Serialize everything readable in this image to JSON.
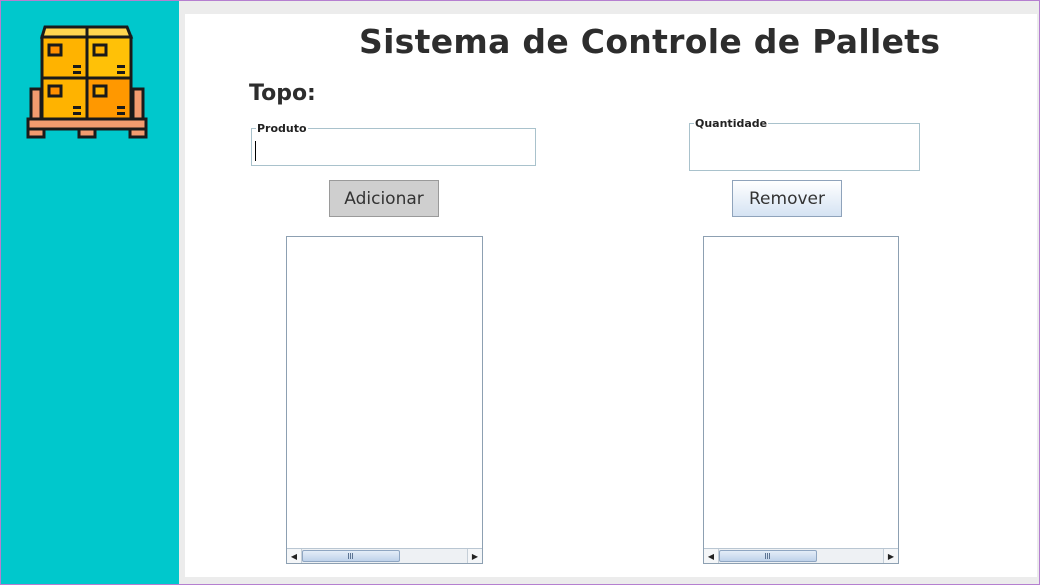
{
  "app": {
    "title": "Sistema de Controle de Pallets",
    "section_label": "Topo:"
  },
  "form": {
    "produto": {
      "legend": "Produto",
      "value": ""
    },
    "quantidade": {
      "legend": "Quantidade",
      "value": ""
    }
  },
  "buttons": {
    "add_label": "Adicionar",
    "remove_label": "Remover"
  },
  "lists": {
    "left_items": [],
    "right_items": []
  },
  "colors": {
    "sidebar": "#00c8cc",
    "box_primary": "#ffb300",
    "box_secondary": "#ff9800",
    "pallet": "#f29b6f"
  },
  "icons": {
    "logo": "pallet-boxes-icon",
    "scroll_left": "arrow-left-icon",
    "scroll_right": "arrow-right-icon"
  }
}
